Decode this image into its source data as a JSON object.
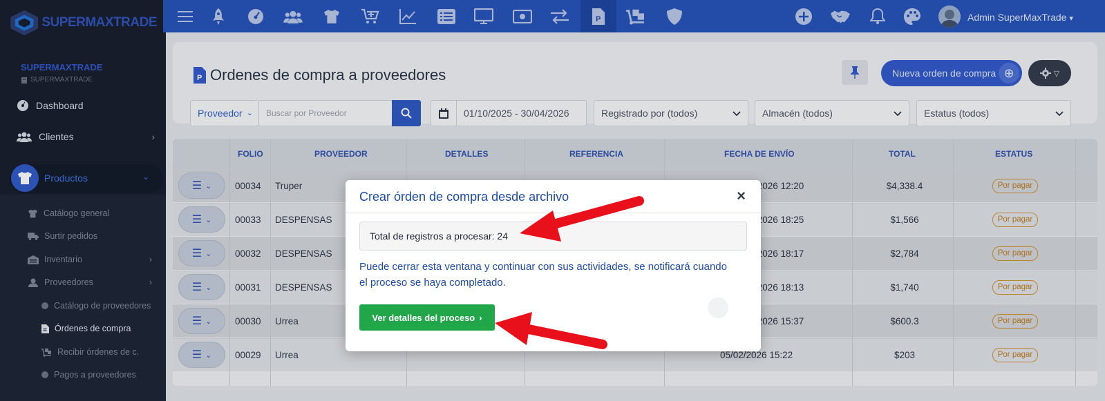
{
  "brand": {
    "logo_text": "SUPERMAXTRADE",
    "name": "SUPERMAXTRADE",
    "subname": "SUPERMAXTRADE"
  },
  "sidebar": {
    "dashboard": "Dashboard",
    "clientes": "Clientes",
    "productos": "Productos",
    "sub": {
      "catalogo": "Catálogo general",
      "surtir": "Surtir pedidos",
      "inventario": "Inventario",
      "proveedores": "Proveedores",
      "catalogo_prov": "Catálogo de proveedores",
      "ordenes": "Órdenes de compra",
      "recibir": "Recibir órdenes de c.",
      "pagos": "Pagos a proveedores"
    }
  },
  "topbar": {
    "user_name": "Admin SuperMaxTrade"
  },
  "page": {
    "title": "Ordenes de compra a proveedores",
    "new_button": "Nueva orden de compra"
  },
  "filters": {
    "proveedor_select": "Proveedor",
    "search_placeholder": "Buscar por Proveedor",
    "date_range": "01/10/2025 - 30/04/2026",
    "registrado": "Registrado por (todos)",
    "almacen": "Almacén (todos)",
    "estatus": "Estatus (todos)"
  },
  "table": {
    "headers": {
      "folio": "FOLIO",
      "proveedor": "PROVEEDOR",
      "detalles": "DETALLES",
      "referencia": "REFERENCIA",
      "fecha": "FECHA DE ENVÍO",
      "total": "TOTAL",
      "estatus": "ESTATUS"
    },
    "rows": [
      {
        "folio": "00034",
        "proveedor": "Truper",
        "fecha": "/2026 12:20",
        "total": "$4,338.4",
        "estatus": "Por pagar"
      },
      {
        "folio": "00033",
        "proveedor": "DESPENSAS",
        "fecha": "/2026 18:25",
        "total": "$1,566",
        "estatus": "Por pagar"
      },
      {
        "folio": "00032",
        "proveedor": "DESPENSAS",
        "fecha": "/2026 18:17",
        "total": "$2,784",
        "estatus": "Por pagar"
      },
      {
        "folio": "00031",
        "proveedor": "DESPENSAS",
        "fecha": "/2026 18:13",
        "total": "$1,740",
        "estatus": "Por pagar"
      },
      {
        "folio": "00030",
        "proveedor": "Urrea",
        "fecha": "/2026 15:37",
        "total": "$600.3",
        "estatus": "Por pagar"
      },
      {
        "folio": "00029",
        "proveedor": "Urrea",
        "fecha": "05/02/2026 15:22",
        "total": "$203",
        "estatus": "Por pagar"
      }
    ]
  },
  "modal": {
    "title": "Crear órden de compra desde archivo",
    "close": "×",
    "records": "Total de registros a procesar: 24",
    "message": "Puede cerrar esta ventana y continuar con sus actividades, se notificará cuando el proceso se haya completado.",
    "button": "Ver detalles del proceso"
  },
  "colors": {
    "topbar": "#2150b8",
    "sidebar": "#141a28",
    "primary": "#2e56c8",
    "success": "#21a64a",
    "warning": "#d1902c",
    "annotation_arrow": "#e8111b"
  }
}
